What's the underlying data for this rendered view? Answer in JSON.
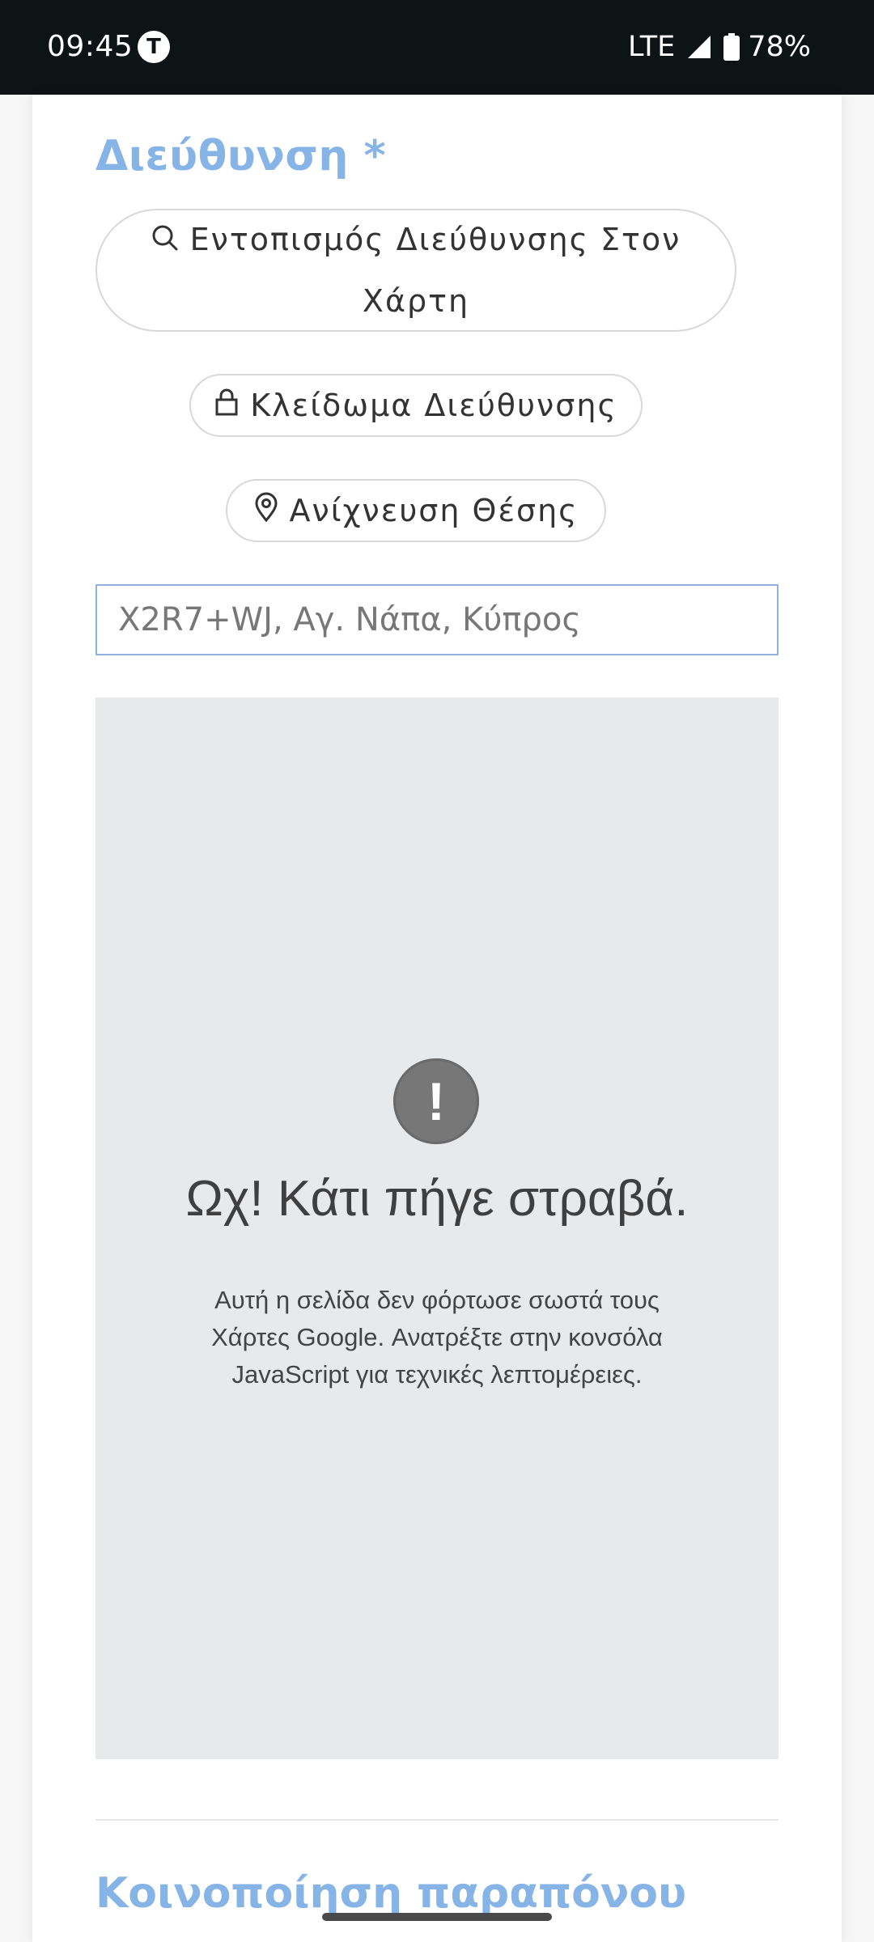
{
  "status_bar": {
    "time": "09:45",
    "app_icon_letter": "T",
    "network": "LTE",
    "battery_percent": "78%",
    "signal_icon": "signal-icon",
    "battery_icon": "battery-icon"
  },
  "address_section": {
    "label": "Διεύθυνση *",
    "label_color": "#86b4e6",
    "search_button": {
      "label": "Εντοπισμός Διεύθυνσης Στον Χάρτη",
      "icon": "search-icon"
    },
    "lock_button": {
      "label": "Κλείδωμα Διεύθυνσης",
      "icon": "lock-icon"
    },
    "locate_button": {
      "label": "Ανίχνευση Θέσης",
      "icon": "location-pin-icon"
    },
    "address_field": {
      "value": "",
      "placeholder": "X2R7+WJ, Αγ. Νάπα, Κύπρος"
    }
  },
  "map": {
    "error_icon": "exclamation-icon",
    "error_title": "Ωχ! Κάτι πήγε στραβά.",
    "error_description": "Αυτή η σελίδα δεν φόρτωσε σωστά τους Χάρτες Google. Ανατρέξτε στην κονσόλα JavaScript για τεχνικές λεπτομέρειες."
  },
  "next_section": {
    "title": "Κοινοποίηση παραπόνου"
  }
}
